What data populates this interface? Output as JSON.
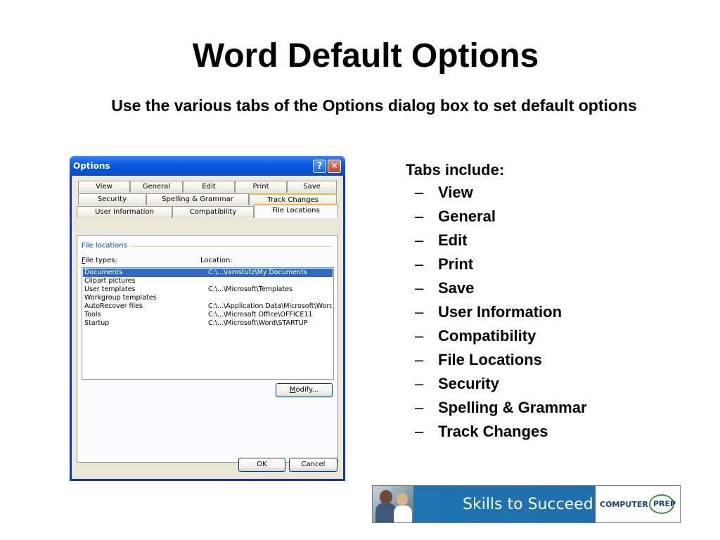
{
  "slide": {
    "title": "Word Default Options",
    "subtitle": "Use the various tabs of the Options dialog box to set default options"
  },
  "dialog": {
    "title": "Options",
    "help_glyph": "?",
    "close_glyph": "✕",
    "tabs_row1": [
      "View",
      "General",
      "Edit",
      "Print",
      "Save"
    ],
    "tabs_row2": [
      "Security",
      "Spelling & Grammar",
      "Track Changes"
    ],
    "tabs_row3": [
      "User Information",
      "Compatibility",
      "File Locations"
    ],
    "active_tab": "File Locations",
    "group_label": "File locations",
    "file_types_label": "File types:",
    "file_types_accel": "F",
    "file_types_rest": "ile types:",
    "location_label": "Location:",
    "rows": [
      {
        "type": "Documents",
        "location": "C:\\...\\iamstutz\\My Documents",
        "selected": true
      },
      {
        "type": "Clipart pictures",
        "location": ""
      },
      {
        "type": "User templates",
        "location": "C:\\...\\Microsoft\\Templates"
      },
      {
        "type": "Workgroup templates",
        "location": ""
      },
      {
        "type": "AutoRecover files",
        "location": "C:\\...\\Application Data\\Microsoft\\Word"
      },
      {
        "type": "Tools",
        "location": "C:\\...\\Microsoft Office\\OFFICE11"
      },
      {
        "type": "Startup",
        "location": "C:\\...\\Microsoft\\Word\\STARTUP"
      }
    ],
    "modify_accel": "M",
    "modify_rest": "odify...",
    "ok_label": "OK",
    "cancel_label": "Cancel"
  },
  "tabs_include": {
    "heading": "Tabs include:",
    "dash": "–",
    "items": [
      "View",
      "General",
      "Edit",
      "Print",
      "Save",
      "User Information",
      "Compatibility",
      "File Locations",
      "Security",
      "Spelling & Grammar",
      "Track Changes"
    ]
  },
  "banner": {
    "text": "Skills to Succeed",
    "logo_left": "COMPUTER",
    "logo_right": "PREP"
  },
  "colors": {
    "title_bar": "#0a5fe8",
    "selection": "#316ac5",
    "banner_blue": "#1f74b4",
    "tab_hot": "#f7b346"
  }
}
